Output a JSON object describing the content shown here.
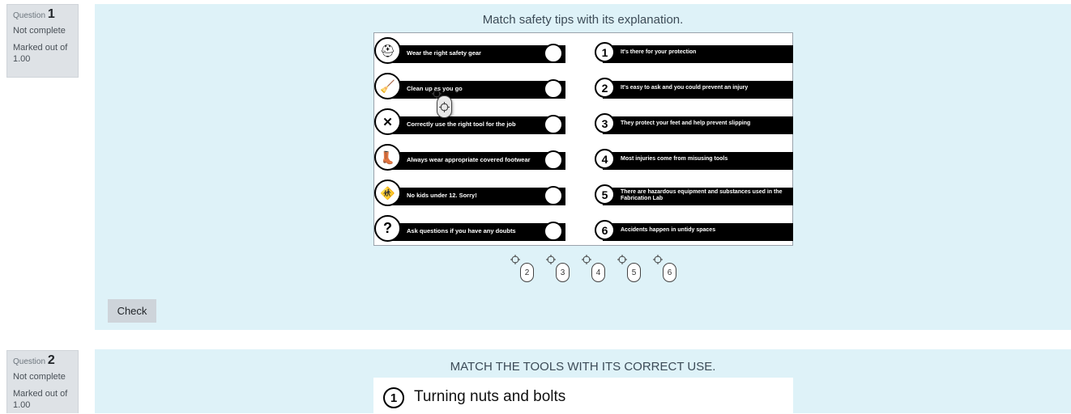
{
  "questions": [
    {
      "number_prefix": "Question",
      "number": "1",
      "status": "Not complete",
      "marked": "Marked out of 1.00",
      "text": "Match safety tips with its explanation.",
      "tips": [
        {
          "icon": "helmet-icon",
          "glyph": "⛑",
          "label": "Wear the right safety gear"
        },
        {
          "icon": "broom-icon",
          "glyph": "🧹",
          "label": "Clean up as you go"
        },
        {
          "icon": "tools-icon",
          "glyph": "✕",
          "label": "Correctly use the right tool for the job"
        },
        {
          "icon": "boot-icon",
          "glyph": "👢",
          "label": "Always wear appropriate covered footwear"
        },
        {
          "icon": "no-kids-icon",
          "glyph": "🚸",
          "label": "No kids under 12. Sorry!"
        },
        {
          "icon": "question-icon",
          "glyph": "?",
          "label": "Ask questions if you have any doubts"
        }
      ],
      "explanations": [
        {
          "num": "1",
          "label": "It's there for your protection"
        },
        {
          "num": "2",
          "label": "It's easy to ask and you could prevent an injury"
        },
        {
          "num": "3",
          "label": "They protect your feet and help prevent slipping"
        },
        {
          "num": "4",
          "label": "Most injuries come from misusing tools"
        },
        {
          "num": "5",
          "label": "There are hazardous equipment and substances used in the Fabrication Lab"
        },
        {
          "num": "6",
          "label": "Accidents happen in untidy spaces"
        }
      ],
      "drag_items": [
        "2",
        "3",
        "4",
        "5",
        "6"
      ],
      "check_label": "Check"
    },
    {
      "number_prefix": "Question",
      "number": "2",
      "status": "Not complete",
      "marked": "Marked out of 1.00",
      "text": "MATCH THE TOOLS WITH ITS CORRECT USE.",
      "first_item_num": "1",
      "first_item": "Turning nuts and bolts"
    }
  ],
  "colors": {
    "panel_bg": "#def2f8",
    "info_bg": "#dee2e6",
    "button_bg": "#ced4da"
  }
}
